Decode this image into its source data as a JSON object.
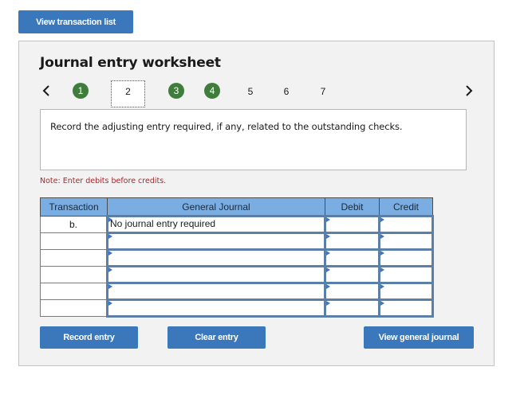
{
  "top_button": {
    "label": "View transaction list"
  },
  "worksheet": {
    "title": "Journal entry worksheet",
    "nav": {
      "prev_icon": "chevron-left-icon",
      "next_icon": "chevron-right-icon",
      "steps": [
        {
          "label": "1",
          "state": "completed"
        },
        {
          "label": "2",
          "state": "current"
        },
        {
          "label": "3",
          "state": "completed"
        },
        {
          "label": "4",
          "state": "completed"
        },
        {
          "label": "5",
          "state": "pending"
        },
        {
          "label": "6",
          "state": "pending"
        },
        {
          "label": "7",
          "state": "pending"
        }
      ]
    },
    "prompt": "Record the adjusting entry required, if any, related to the outstanding checks.",
    "note": "Note: Enter debits before credits.",
    "table": {
      "headers": [
        "Transaction",
        "General Journal",
        "Debit",
        "Credit"
      ],
      "rows": [
        {
          "transaction": "b.",
          "account": "No journal entry required",
          "debit": "",
          "credit": ""
        },
        {
          "transaction": "",
          "account": "",
          "debit": "",
          "credit": ""
        },
        {
          "transaction": "",
          "account": "",
          "debit": "",
          "credit": ""
        },
        {
          "transaction": "",
          "account": "",
          "debit": "",
          "credit": ""
        },
        {
          "transaction": "",
          "account": "",
          "debit": "",
          "credit": ""
        },
        {
          "transaction": "",
          "account": "",
          "debit": "",
          "credit": ""
        }
      ]
    },
    "buttons": {
      "record": "Record entry",
      "clear": "Clear entry",
      "view_journal": "View general journal"
    }
  },
  "colors": {
    "button_blue": "#3a77bb",
    "step_complete_green": "#3f7d3c",
    "header_blue": "#7aaee3",
    "note_red": "#a8272b",
    "input_border": "#5c7fa8"
  }
}
